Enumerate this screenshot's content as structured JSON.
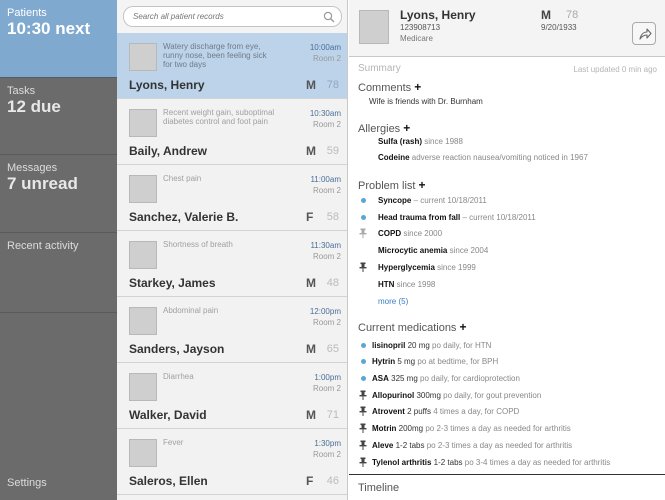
{
  "nav": {
    "patients": {
      "label": "Patients",
      "value": "10:30 next"
    },
    "tasks": {
      "label": "Tasks",
      "value": "12 due"
    },
    "messages": {
      "label": "Messages",
      "value": "7 unread"
    },
    "recent": {
      "label": "Recent activity"
    },
    "settings": {
      "label": "Settings"
    }
  },
  "search": {
    "placeholder": "Search all patient records",
    "icon": "search-icon"
  },
  "patients": [
    {
      "complaint": "Watery discharge from eye, runny nose, been feeling sick for two days",
      "time": "10:00am",
      "room": "Room 2",
      "name": "Lyons, Henry",
      "sex": "M",
      "age": "78",
      "selected": true
    },
    {
      "complaint": "Recent weight gain, suboptimal diabetes control and foot pain",
      "time": "10:30am",
      "room": "Room 2",
      "name": "Baily, Andrew",
      "sex": "M",
      "age": "59"
    },
    {
      "complaint": "Chest pain",
      "time": "11:00am",
      "room": "Room 2",
      "name": "Sanchez, Valerie B.",
      "sex": "F",
      "age": "58"
    },
    {
      "complaint": "Shortness of breath",
      "time": "11:30am",
      "room": "Room 2",
      "name": "Starkey, James",
      "sex": "M",
      "age": "48"
    },
    {
      "complaint": "Abdominal pain",
      "time": "12:00pm",
      "room": "Room 2",
      "name": "Sanders, Jayson",
      "sex": "M",
      "age": "65"
    },
    {
      "complaint": "Diarrhea",
      "time": "1:00pm",
      "room": "Room 2",
      "name": "Walker, David",
      "sex": "M",
      "age": "71"
    },
    {
      "complaint": "Fever",
      "time": "1:30pm",
      "room": "Room 2",
      "name": "Saleros, Ellen",
      "sex": "F",
      "age": "46"
    }
  ],
  "detail": {
    "name": "Lyons, Henry",
    "mrn": "123908713",
    "insurance": "Medicare",
    "sex": "M",
    "age": "78",
    "dob": "9/20/1933",
    "summary_label": "Summary",
    "updated": "Last updated 0 min ago",
    "comments": {
      "title": "Comments",
      "plus": "+",
      "items": [
        "Wife is friends with Dr. Burnham"
      ]
    },
    "allergies": {
      "title": "Allergies",
      "plus": "+",
      "items": [
        {
          "name": "Sulfa (rash)",
          "detail": " since 1988"
        },
        {
          "name": "Codeine",
          "detail": " adverse reaction nausea/vomiting noticed in 1967"
        }
      ]
    },
    "problems": {
      "title": "Problem list",
      "plus": "+",
      "items": [
        {
          "marker": "dot",
          "name": "Syncope",
          "detail": " – current 10/18/2011"
        },
        {
          "marker": "dot",
          "name": "Head trauma from fall",
          "detail": " – current 10/18/2011"
        },
        {
          "marker": "pin-light",
          "name": "COPD",
          "detail": " since 2000"
        },
        {
          "marker": "none",
          "name": "Microcytic anemia",
          "detail": " since 2004"
        },
        {
          "marker": "pin",
          "name": "Hyperglycemia",
          "detail": " since 1999"
        },
        {
          "marker": "none",
          "name": "HTN",
          "detail": " since 1998"
        }
      ],
      "more": "more (5)"
    },
    "medications": {
      "title": "Current medications",
      "plus": "+",
      "items": [
        {
          "marker": "dot",
          "name": "lisinopril",
          "dose": " 20 mg",
          "detail": " po daily, for HTN"
        },
        {
          "marker": "dot",
          "name": "Hytrin",
          "dose": " 5 mg",
          "detail": " po at bedtime, for BPH"
        },
        {
          "marker": "dot",
          "name": "ASA",
          "dose": " 325 mg",
          "detail": " po daily, for cardioprotection"
        },
        {
          "marker": "pin",
          "name": "Allopurinol",
          "dose": " 300mg",
          "detail": " po daily, for gout prevention"
        },
        {
          "marker": "pin",
          "name": "Atrovent",
          "dose": " 2 puffs",
          "detail": " 4 times a day, for COPD"
        },
        {
          "marker": "pin",
          "name": "Motrin",
          "dose": " 200mg",
          "detail": " po 2-3 times a day as needed for arthritis"
        },
        {
          "marker": "pin",
          "name": "Aleve",
          "dose": " 1-2 tabs",
          "detail": " po 2-3 times a day as needed for arthritis"
        },
        {
          "marker": "pin",
          "name": "Tylenol arthritis",
          "dose": " 1-2 tabs",
          "detail": " po 3-4 times a day as needed for arthritis"
        }
      ]
    },
    "timeline": "Timeline"
  },
  "colors": {
    "accent": "#7fa9cf",
    "selected_row": "#bcd3ea",
    "bullet": "#5aa6d6",
    "link": "#3b7cc4"
  }
}
